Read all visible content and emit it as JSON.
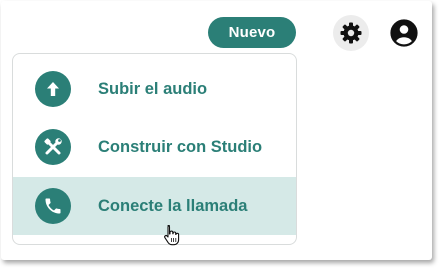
{
  "header": {
    "new_button_label": "Nuevo",
    "settings_icon": "gear-icon",
    "account_icon": "user-circle-icon"
  },
  "menu": {
    "items": [
      {
        "label": "Subir el audio",
        "icon": "arrow-up-icon"
      },
      {
        "label": "Construir con Studio",
        "icon": "tools-icon"
      },
      {
        "label": "Conecte la llamada",
        "icon": "phone-icon",
        "hovered": true
      }
    ]
  },
  "colors": {
    "accent": "#2b7f77",
    "hover_background": "#d5e9e7",
    "settings_button_background": "#ececec"
  }
}
